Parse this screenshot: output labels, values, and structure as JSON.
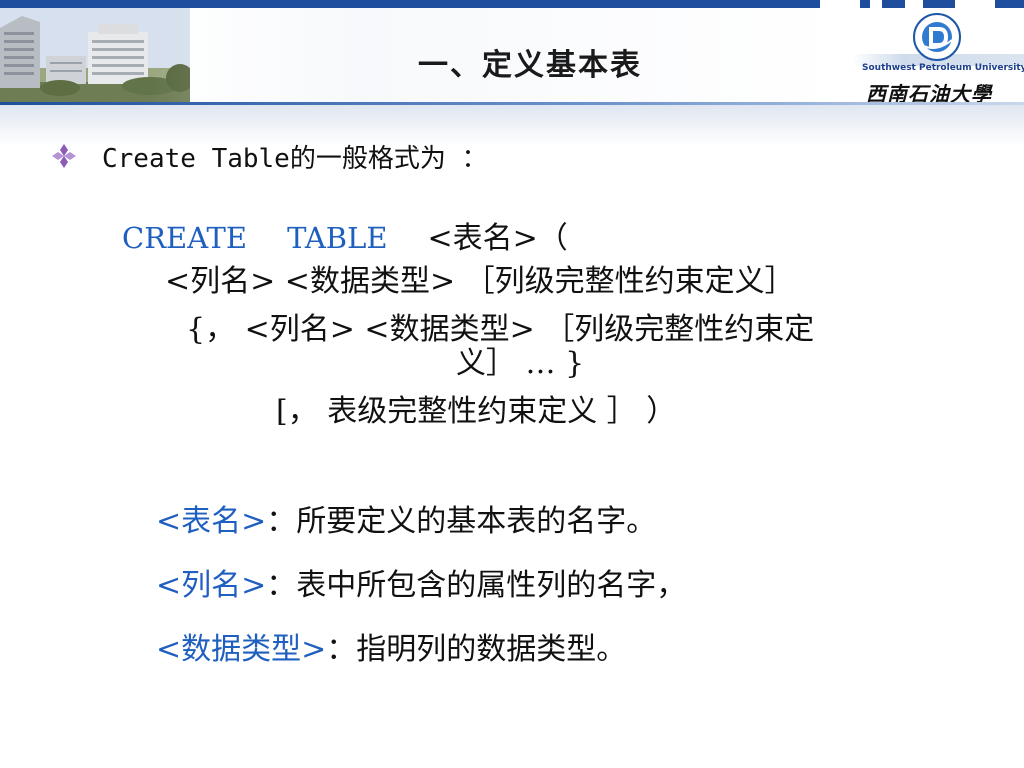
{
  "slide": {
    "title": "一、定义基本表"
  },
  "logo": {
    "english": "Southwest Petroleum University",
    "chinese": "西南石油大學"
  },
  "bullet": {
    "text": "Create Table的一般格式为 ："
  },
  "syntax": {
    "line1_keyword1": "CREATE",
    "line1_keyword2": "TABLE",
    "line1_rest": "<表名>（",
    "line2": "<列名> <数据类型> ［列级完整性约束定义］",
    "line3": "{， <列名> <数据类型>  ［列级完整性约束定",
    "line4": "义］ … }",
    "line5": "[， 表级完整性约束定义 ］ ）"
  },
  "definitions": [
    {
      "term": "<表名>",
      "desc": "：所要定义的基本表的名字。"
    },
    {
      "term": "<列名>",
      "desc": "：表中所包含的属性列的名字，"
    },
    {
      "term": "<数据类型>",
      "desc": "：指明列的数据类型。"
    }
  ],
  "colors": {
    "accent": "#1f5fbf",
    "header_bar": "#1f4e9e",
    "bullet": "#7a4fa8"
  }
}
